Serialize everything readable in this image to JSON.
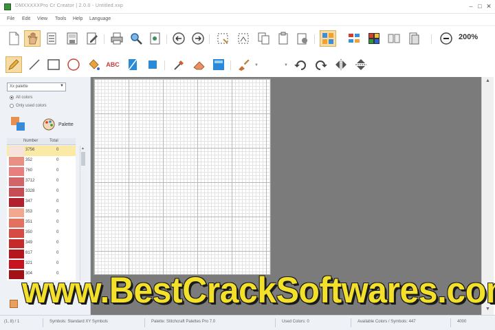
{
  "titlebar": {
    "title": "DMXXXXXPro Cr Creator  | 2.0.0 - Untitled.xxp",
    "minimize_glyph": "–",
    "maximize_glyph": "□",
    "close_glyph": "✕"
  },
  "menu": {
    "items": [
      "File",
      "Edit",
      "View",
      "Tools",
      "Help",
      "Language"
    ]
  },
  "toolbar1": {
    "zoom_label": "200%",
    "icons": [
      "new-document-icon",
      "open-hand-icon",
      "open-folder-icon",
      "save-icon",
      "save-as-icon",
      "edit-document-icon",
      "print-icon",
      "print-preview-icon",
      "export-icon",
      "rotate-left-icon",
      "rotate-right-icon",
      "select-region-icon",
      "select-pattern-icon",
      "copy-icon",
      "paste-icon",
      "paste-special-icon",
      "color-blocks-icon",
      "layout-icon",
      "palette-grid-icon",
      "symbols-icon",
      "page-setup-icon",
      "zoom-out-icon"
    ]
  },
  "toolbar2": {
    "text_tool_label": "ABC",
    "icons": [
      "pencil-icon",
      "line-icon",
      "rectangle-icon",
      "circle-icon",
      "fill-bucket-icon",
      "text-tool-icon",
      "half-stitch-icon",
      "quarter-stitch-icon",
      "picker-icon",
      "eraser-icon",
      "backstitch-icon",
      "brush-icon",
      "undo-icon",
      "redo-icon",
      "flip-horizontal-icon",
      "flip-vertical-icon"
    ]
  },
  "left_panel": {
    "palette_select": "Xx palette",
    "radio_options": [
      {
        "label": "All colors",
        "checked": true
      },
      {
        "label": "Only used colors",
        "checked": false
      }
    ],
    "palette_button_label": "Palette",
    "table_headers": [
      "Number",
      "Total"
    ],
    "rows": [
      {
        "code": "3756",
        "count": "0",
        "color": "#f6e3dd",
        "selected": true
      },
      {
        "code": "352",
        "count": "0",
        "color": "#e88f86"
      },
      {
        "code": "760",
        "count": "0",
        "color": "#e77f7f"
      },
      {
        "code": "3712",
        "count": "0",
        "color": "#d3646a"
      },
      {
        "code": "3328",
        "count": "0",
        "color": "#c64c55"
      },
      {
        "code": "347",
        "count": "0",
        "color": "#b1202f"
      },
      {
        "code": "353",
        "count": "0",
        "color": "#f2a890"
      },
      {
        "code": "351",
        "count": "0",
        "color": "#e2725f"
      },
      {
        "code": "350",
        "count": "0",
        "color": "#d64c45"
      },
      {
        "code": "349",
        "count": "0",
        "color": "#c52b2b"
      },
      {
        "code": "817",
        "count": "0",
        "color": "#b3161d"
      },
      {
        "code": "321",
        "count": "0",
        "color": "#c7131f"
      },
      {
        "code": "304",
        "count": "0",
        "color": "#a41018"
      }
    ]
  },
  "status": {
    "items": [
      "(1, 8) / 1",
      "Symbols: Standard XY Symbols",
      "Palette: Stitchcraft Palettes Pro 7.0",
      "Used Colors: 0",
      "Available Colors / Symbols: 447",
      "4000"
    ]
  },
  "watermark": {
    "text": "www.BestCrackSoftwares.com",
    "color": "#f3e02a"
  },
  "colors": {
    "workspace_bg": "#7b7b7b",
    "panel_bg": "#eef2f7",
    "selected_tool": "#f6dca4"
  }
}
